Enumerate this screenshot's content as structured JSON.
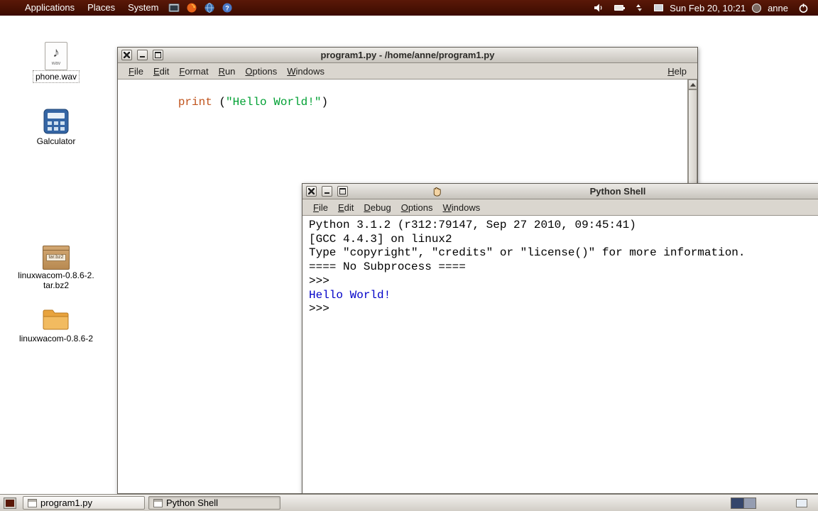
{
  "top_panel": {
    "menus": [
      "Applications",
      "Places",
      "System"
    ],
    "clock": "Sun Feb 20, 10:21",
    "user": "anne"
  },
  "desktop_icons": [
    {
      "label": "phone.wav",
      "badge": "wav"
    },
    {
      "label": "Galculator"
    },
    {
      "label": "linuxwacom-0.8.6-2.\ntar.bz2",
      "badge": "tar.bz2"
    },
    {
      "label": "linuxwacom-0.8.6-2"
    }
  ],
  "editor_window": {
    "title": "program1.py - /home/anne/program1.py",
    "menus": [
      "File",
      "Edit",
      "Format",
      "Run",
      "Options",
      "Windows"
    ],
    "help_menu": "Help",
    "code_segments": [
      {
        "text": "print",
        "color": "#c0531c"
      },
      {
        "text": " (",
        "color": "#000000"
      },
      {
        "text": "\"Hello World!\"",
        "color": "#00a033"
      },
      {
        "text": ")",
        "color": "#000000"
      }
    ]
  },
  "shell_window": {
    "title": "Python Shell",
    "menus": [
      "File",
      "Edit",
      "Debug",
      "Options",
      "Windows"
    ],
    "lines": [
      {
        "text": "Python 3.1.2 (r312:79147, Sep 27 2010, 09:45:41)",
        "color": "#000000"
      },
      {
        "text": "[GCC 4.4.3] on linux2",
        "color": "#000000"
      },
      {
        "text": "Type \"copyright\", \"credits\" or \"license()\" for more information.",
        "color": "#000000"
      },
      {
        "text": "==== No Subprocess ====",
        "color": "#000000"
      },
      {
        "text": ">>> ",
        "color": "#000000"
      },
      {
        "text": "Hello World!",
        "color": "#0000c8"
      },
      {
        "text": ">>> ",
        "color": "#000000"
      }
    ]
  },
  "taskbar": {
    "buttons": [
      "program1.py",
      "Python Shell"
    ]
  }
}
